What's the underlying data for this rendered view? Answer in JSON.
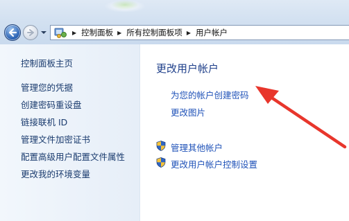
{
  "addressbar": {
    "breadcrumbs": [
      "控制面板",
      "所有控制面板项",
      "用户帐户"
    ]
  },
  "sidebar": {
    "home_label": "控制面板主页",
    "items": [
      {
        "label": "管理您的凭据"
      },
      {
        "label": "创建密码重设盘"
      },
      {
        "label": "链接联机 ID"
      },
      {
        "label": "管理文件加密证书"
      },
      {
        "label": "配置高级用户配置文件属性"
      },
      {
        "label": "更改我的环境变量"
      }
    ]
  },
  "main": {
    "heading": "更改用户帐户",
    "links": [
      {
        "label": "为您的帐户创建密码"
      },
      {
        "label": "更改图片"
      }
    ],
    "shield_links": [
      {
        "label": "管理其他帐户"
      },
      {
        "label": "更改用户帐户控制设置"
      }
    ]
  },
  "colors": {
    "heading": "#1e3f8a",
    "link": "#1f52b8",
    "sidebar_text": "#1a3b6e",
    "annotation_arrow": "#e8362c"
  },
  "icons": [
    "back-arrow-icon",
    "forward-arrow-icon",
    "recent-pages-icon",
    "control-panel-icon",
    "uac-shield-icon"
  ]
}
